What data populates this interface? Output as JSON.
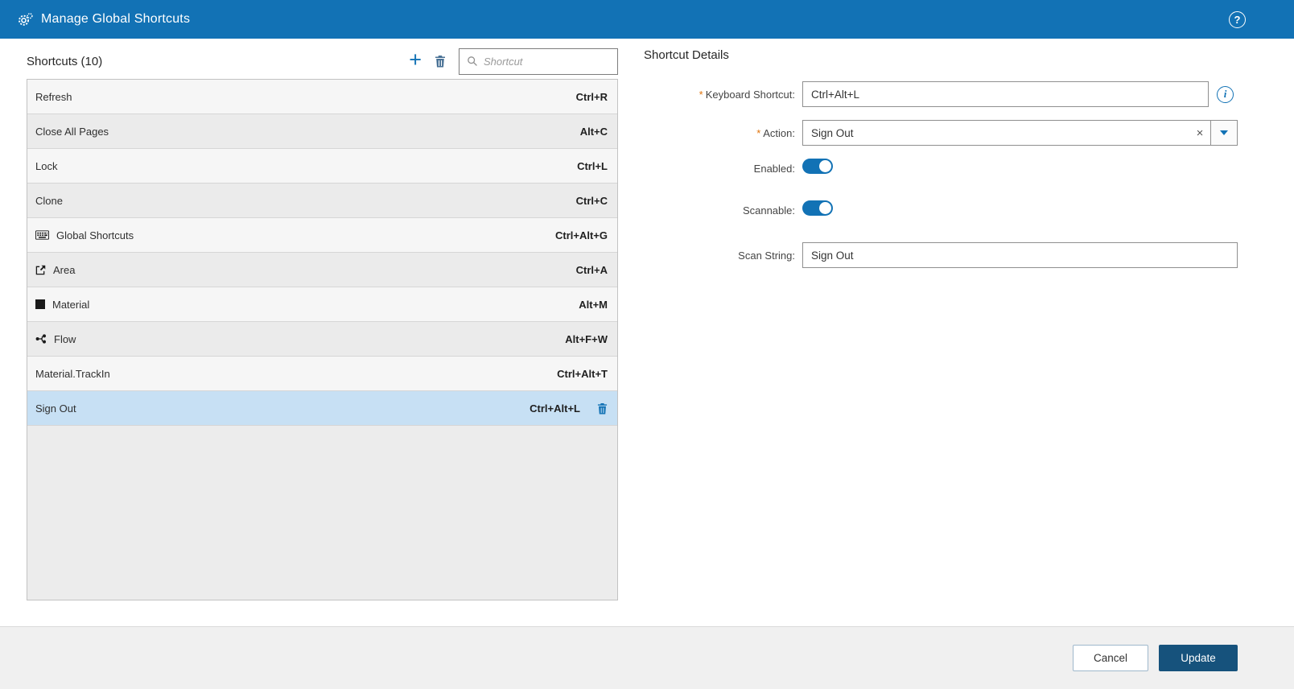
{
  "colors": {
    "accent": "#1272b5",
    "header_bg": "#1272b5",
    "selected_row": "#c7e0f4",
    "update_button": "#16527c",
    "required_marker": "#e0740c"
  },
  "icons": {
    "plus": "+",
    "clear": "×",
    "help": "?",
    "info": "i"
  },
  "header": {
    "title": "Manage Global Shortcuts"
  },
  "left_panel": {
    "title": "Shortcuts (10)",
    "search": {
      "placeholder": "Shortcut"
    },
    "rows": [
      {
        "label": "Refresh",
        "shortcut": "Ctrl+R"
      },
      {
        "label": "Close All Pages",
        "shortcut": "Alt+C"
      },
      {
        "label": "Lock",
        "shortcut": "Ctrl+L"
      },
      {
        "label": "Clone",
        "shortcut": "Ctrl+C"
      },
      {
        "label": "Global Shortcuts",
        "shortcut": "Ctrl+Alt+G",
        "icon": "keyboard-icon"
      },
      {
        "label": "Area",
        "shortcut": "Ctrl+A",
        "icon": "area-icon"
      },
      {
        "label": "Material",
        "shortcut": "Alt+M",
        "icon": "material-icon"
      },
      {
        "label": "Flow",
        "shortcut": "Alt+F+W",
        "icon": "flow-icon"
      },
      {
        "label": "Material.TrackIn",
        "shortcut": "Ctrl+Alt+T"
      },
      {
        "label": "Sign Out",
        "shortcut": "Ctrl+Alt+L",
        "selected": true
      }
    ]
  },
  "details": {
    "title": "Shortcut Details",
    "required_marker": "*",
    "fields": {
      "keyboard_shortcut": {
        "label": "Keyboard Shortcut:",
        "value": "Ctrl+Alt+L",
        "required": true
      },
      "action": {
        "label": "Action:",
        "value": "Sign Out",
        "required": true
      },
      "enabled": {
        "label": "Enabled:",
        "state": "on"
      },
      "scannable": {
        "label": "Scannable:",
        "state": "on"
      },
      "scan_string": {
        "label": "Scan String:",
        "value": "Sign Out"
      }
    }
  },
  "footer": {
    "cancel": "Cancel",
    "update": "Update"
  }
}
